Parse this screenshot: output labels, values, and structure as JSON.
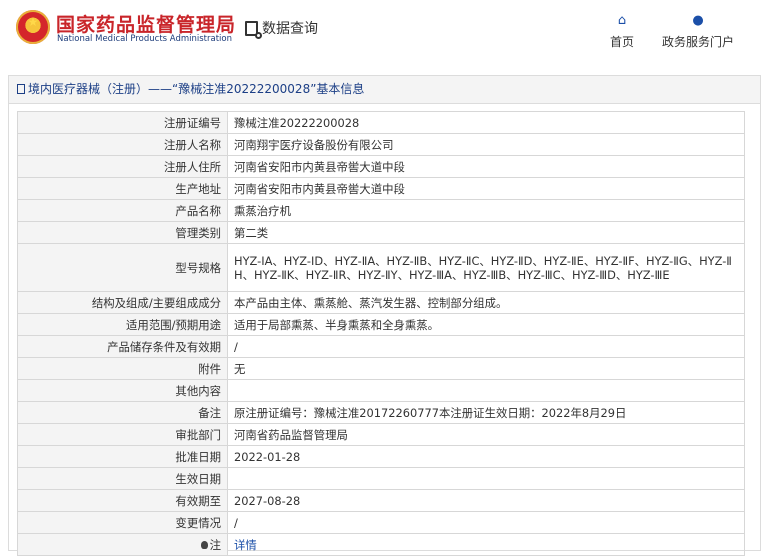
{
  "header": {
    "logo_cn": "国家药品监督管理局",
    "logo_en": "National Medical Products Administration",
    "query_label": "数据查询",
    "nav": [
      {
        "label": "首页",
        "icon": "home-icon"
      },
      {
        "label": "政务服务门户",
        "icon": "user-icon"
      }
    ]
  },
  "panel": {
    "title": "境内医疗器械（注册）——“豫械注准20222200028”基本信息"
  },
  "rows": [
    {
      "label": "注册证编号",
      "value": "豫械注准20222200028"
    },
    {
      "label": "注册人名称",
      "value": "河南翔宇医疗设备股份有限公司"
    },
    {
      "label": "注册人住所",
      "value": "河南省安阳市内黄县帝喾大道中段"
    },
    {
      "label": "生产地址",
      "value": "河南省安阳市内黄县帝喾大道中段"
    },
    {
      "label": "产品名称",
      "value": "熏蒸治疗机"
    },
    {
      "label": "管理类别",
      "value": "第二类"
    },
    {
      "label": "型号规格",
      "value": "HYZ-ⅠA、HYZ-ⅠD、HYZ-ⅡA、HYZ-ⅡB、HYZ-ⅡC、HYZ-ⅡD、HYZ-ⅡE、HYZ-ⅡF、HYZ-ⅡG、HYZ-ⅡH、HYZ-ⅡK、HYZ-ⅡR、HYZ-ⅡY、HYZ-ⅢA、HYZ-ⅢB、HYZ-ⅢC、HYZ-ⅢD、HYZ-ⅢE"
    },
    {
      "label": "结构及组成/主要组成成分",
      "value": "本产品由主体、熏蒸舱、蒸汽发生器、控制部分组成。"
    },
    {
      "label": "适用范围/预期用途",
      "value": "适用于局部熏蒸、半身熏蒸和全身熏蒸。"
    },
    {
      "label": "产品储存条件及有效期",
      "value": "/"
    },
    {
      "label": "附件",
      "value": "无"
    },
    {
      "label": "其他内容",
      "value": ""
    },
    {
      "label": "备注",
      "value": "原注册证编号：豫械注准20172260777本注册证生效日期：2022年8月29日"
    },
    {
      "label": "审批部门",
      "value": "河南省药品监督管理局"
    },
    {
      "label": "批准日期",
      "value": "2022-01-28"
    },
    {
      "label": "生效日期",
      "value": ""
    },
    {
      "label": "有效期至",
      "value": "2027-08-28"
    },
    {
      "label": "变更情况",
      "value": "/"
    },
    {
      "label": "注",
      "value": "详情"
    }
  ]
}
